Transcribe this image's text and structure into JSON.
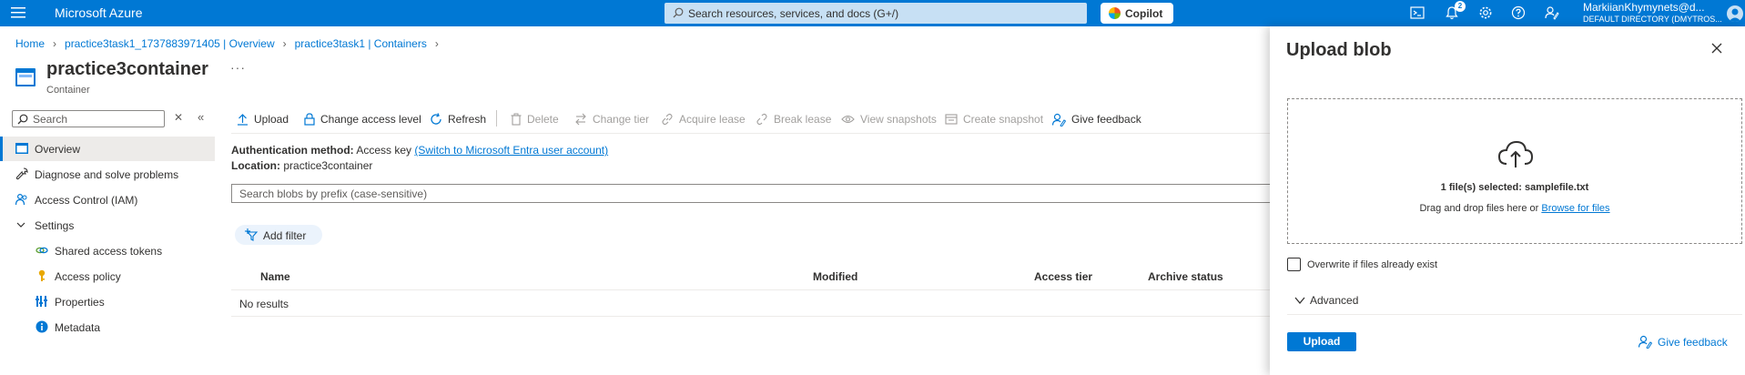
{
  "topbar": {
    "brand": "Microsoft Azure",
    "search_placeholder": "Search resources, services, and docs (G+/)",
    "copilot_label": "Copilot",
    "notification_count": "2",
    "user_name": "MarkiianKhymynets@d...",
    "user_directory": "DEFAULT DIRECTORY (DMYTROS..."
  },
  "breadcrumb": {
    "items": [
      "Home",
      "practice3task1_1737883971405 | Overview",
      "practice3task1 | Containers"
    ]
  },
  "header": {
    "title": "practice3container",
    "subtitle": "Container",
    "more": "···"
  },
  "nav": {
    "search_placeholder": "Search",
    "items": [
      {
        "label": "Overview",
        "icon": "container-icon"
      },
      {
        "label": "Diagnose and solve problems",
        "icon": "wrench-icon"
      },
      {
        "label": "Access Control (IAM)",
        "icon": "people-icon"
      },
      {
        "label": "Settings",
        "icon": "chevron-down-icon"
      },
      {
        "label": "Shared access tokens",
        "icon": "link-icon"
      },
      {
        "label": "Access policy",
        "icon": "key-icon"
      },
      {
        "label": "Properties",
        "icon": "properties-icon"
      },
      {
        "label": "Metadata",
        "icon": "info-icon"
      }
    ]
  },
  "commands": {
    "upload": "Upload",
    "change_access_level": "Change access level",
    "refresh": "Refresh",
    "delete": "Delete",
    "change_tier": "Change tier",
    "acquire_lease": "Acquire lease",
    "break_lease": "Break lease",
    "view_snapshots": "View snapshots",
    "create_snapshot": "Create snapshot",
    "give_feedback": "Give feedback"
  },
  "info": {
    "auth_label": "Authentication method:",
    "auth_value": "Access key",
    "auth_link": "(Switch to Microsoft Entra user account)",
    "location_label": "Location:",
    "location_value": "practice3container"
  },
  "blobs": {
    "search_placeholder": "Search blobs by prefix (case-sensitive)",
    "add_filter": "Add filter",
    "columns": [
      "Name",
      "Modified",
      "Access tier",
      "Archive status"
    ],
    "empty_text": "No results"
  },
  "panel": {
    "title": "Upload blob",
    "files_selected_prefix": "1 file(s) selected:",
    "files_selected_name": "samplefile.txt",
    "drag_text": "Drag and drop files here  or",
    "browse_link": "Browse for files",
    "overwrite_label": "Overwrite if files already exist",
    "overwrite_checked": false,
    "advanced_label": "Advanced",
    "upload_button": "Upload",
    "give_feedback": "Give feedback"
  },
  "colors": {
    "accent": "#0078d4",
    "topbar": "#0078d4",
    "search_bg": "#c7e0f4",
    "nav_active_bg": "#edebe9"
  }
}
